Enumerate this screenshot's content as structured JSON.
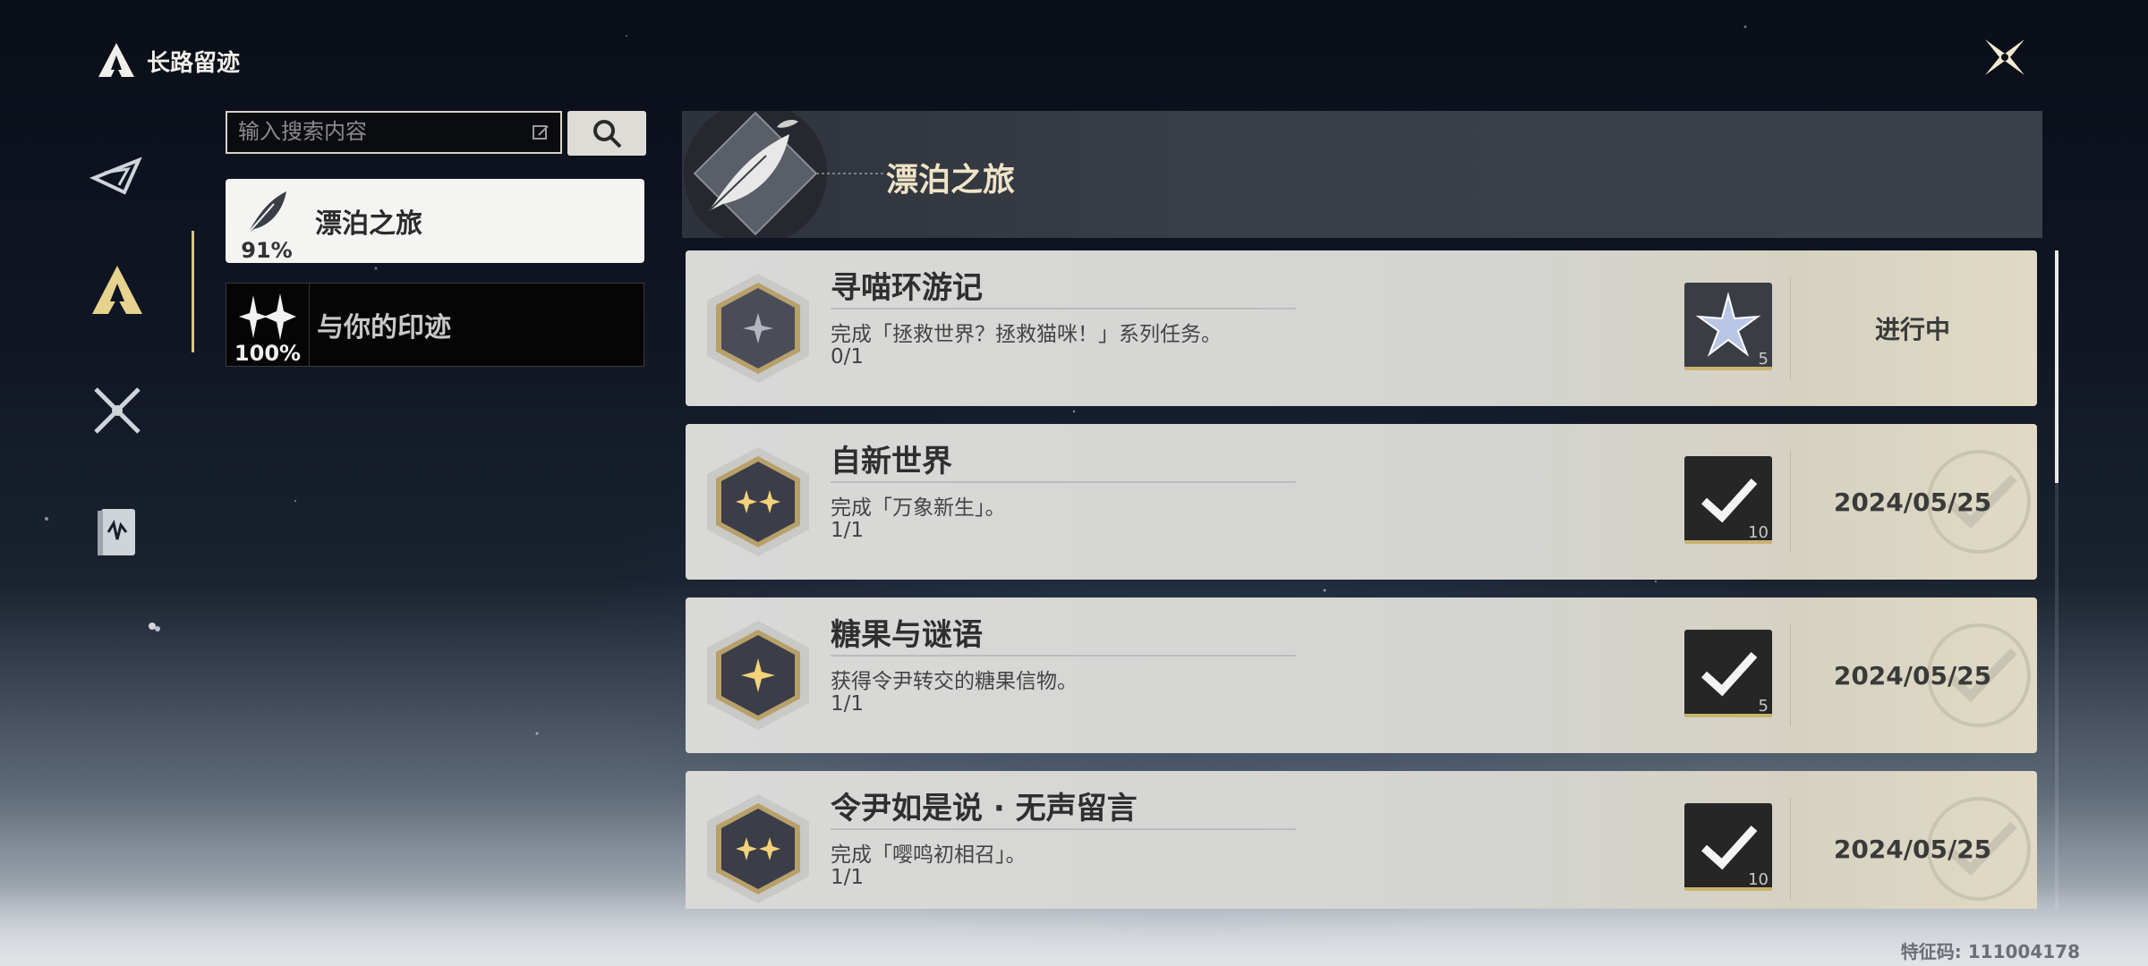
{
  "header": {
    "title": "长路留迹"
  },
  "search": {
    "placeholder": "输入搜索内容",
    "value": ""
  },
  "rail": {
    "items": [
      {
        "name": "rail-item-overview"
      },
      {
        "name": "rail-item-long-road",
        "active": true
      },
      {
        "name": "rail-item-battle"
      },
      {
        "name": "rail-item-records"
      }
    ]
  },
  "categories": [
    {
      "label": "漂泊之旅",
      "percent": "91%",
      "active": true
    },
    {
      "label": "与你的印迹",
      "percent": "100%",
      "active": false
    }
  ],
  "panel": {
    "title": "漂泊之旅"
  },
  "achievements": [
    {
      "name": "寻喵环游记",
      "desc": "完成「拯救世界？拯救猫咪！」系列任务。",
      "progress": "0/1",
      "reward_qty": "5",
      "status": "进行中",
      "completed": false,
      "stars": 1
    },
    {
      "name": "自新世界",
      "desc": "完成「万象新生」。",
      "progress": "1/1",
      "reward_qty": "10",
      "status": "2024/05/25",
      "completed": true,
      "stars": 2
    },
    {
      "name": "糖果与谜语",
      "desc": "获得令尹转交的糖果信物。",
      "progress": "1/1",
      "reward_qty": "5",
      "status": "2024/05/25",
      "completed": true,
      "stars": 1
    },
    {
      "name": "令尹如是说 · 无声留言",
      "desc": "完成「嘤鸣初相召」。",
      "progress": "1/1",
      "reward_qty": "10",
      "status": "2024/05/25",
      "completed": true,
      "stars": 2
    }
  ],
  "footer": {
    "code": "特征码: 111004178"
  },
  "colors": {
    "accent_gold": "#d8c488",
    "card_bg": "#d9d9d8",
    "active_category": "#f4f4f2"
  }
}
